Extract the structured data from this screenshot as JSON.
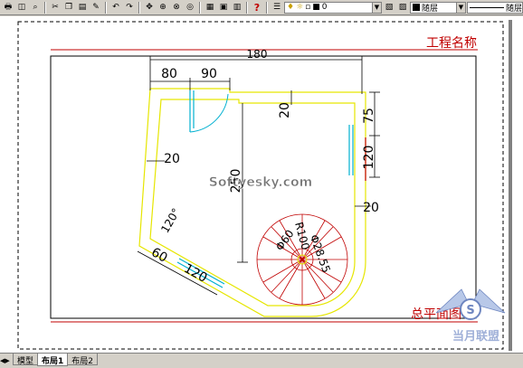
{
  "toolbar": {
    "layer_value": "0",
    "color_value": "随层",
    "linetype_value": "随层",
    "help_label": "?"
  },
  "drawing": {
    "title_top": "工程名称",
    "title_bottom": "总平面图",
    "dims": {
      "top_overall": "180",
      "top_left": "80",
      "top_right": "90",
      "right_top": "75",
      "right_mid": "120",
      "right_20": "20",
      "left_20": "20",
      "upper_20": "20",
      "center_vertical": "250",
      "angle": "120°",
      "slant_60": "60",
      "slant_120": "120",
      "radius": "R100",
      "phi_left": "Φ60",
      "phi_right": "Φ28.55"
    },
    "watermark": "Softyesky.com",
    "logo_text": "当月联盟"
  },
  "tabs": {
    "model": "模型",
    "layout1": "布局1",
    "layout2": "布局2"
  },
  "colors": {
    "outline": "#e6e600",
    "dimension": "#000000",
    "stair": "#c00000",
    "window": "#00b0d0",
    "frame": "#c00000"
  }
}
